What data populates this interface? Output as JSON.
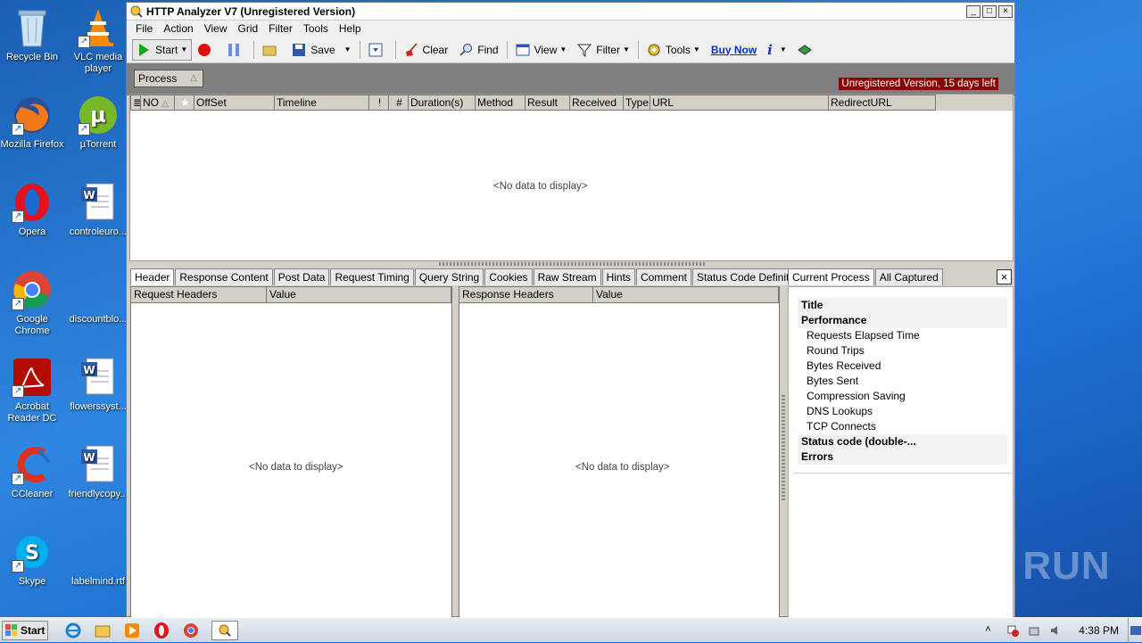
{
  "desktop": {
    "icons": [
      {
        "label": "Recycle Bin"
      },
      {
        "label": "VLC media player"
      },
      {
        "label": "Mozilla Firefox"
      },
      {
        "label": "µTorrent"
      },
      {
        "label": "Opera"
      },
      {
        "label": "controleuro..."
      },
      {
        "label": "Google Chrome"
      },
      {
        "label": "discountblo..."
      },
      {
        "label": "Acrobat Reader DC"
      },
      {
        "label": "flowerssyst..."
      },
      {
        "label": "CCleaner"
      },
      {
        "label": "friendlycopy..."
      },
      {
        "label": "Skype"
      },
      {
        "label": "labelmind.rtf"
      }
    ],
    "watermark": "ANY RUN"
  },
  "window": {
    "title": "HTTP Analyzer V7  (Unregistered Version)",
    "controls": [
      "_",
      "□",
      "×"
    ]
  },
  "menu": [
    "File",
    "Action",
    "View",
    "Grid",
    "Filter",
    "Tools",
    "Help"
  ],
  "toolbar": {
    "start": "Start",
    "save": "Save",
    "clear": "Clear",
    "find": "Find",
    "view": "View",
    "filter": "Filter",
    "tools": "Tools",
    "buy_now": "Buy Now"
  },
  "strip": {
    "process_label": "Process",
    "unregistered_notice": "Unregistered Version, 15 days left"
  },
  "grid": {
    "columns": [
      "",
      "NO",
      "",
      "OffSet",
      "Timeline",
      "!",
      "#",
      "Duration(s)",
      "Method",
      "Result",
      "Received",
      "Type",
      "URL",
      "RedirectURL"
    ],
    "empty_text": "<No data to display>"
  },
  "detail_tabs": [
    "Header",
    "Response Content",
    "Post Data",
    "Request Timing",
    "Query String",
    "Cookies",
    "Raw Stream",
    "Hints",
    "Comment",
    "Status Code Definition"
  ],
  "request_panel": {
    "col_name": "Request Headers",
    "col_value": "Value",
    "empty_text": "<No data to display>"
  },
  "response_panel": {
    "col_name": "Response Headers",
    "col_value": "Value",
    "empty_text": "<No data to display>"
  },
  "right_tabs": [
    "Current Process",
    "All Captured"
  ],
  "right_tree": [
    {
      "label": "Title",
      "kind": "bold"
    },
    {
      "label": "Performance",
      "kind": "bold"
    },
    {
      "label": "Requests Elapsed Time",
      "kind": "sub"
    },
    {
      "label": "Round Trips",
      "kind": "sub"
    },
    {
      "label": "Bytes Received",
      "kind": "sub"
    },
    {
      "label": "Bytes Sent",
      "kind": "sub"
    },
    {
      "label": "Compression Saving",
      "kind": "sub"
    },
    {
      "label": "DNS Lookups",
      "kind": "sub"
    },
    {
      "label": "TCP Connects",
      "kind": "sub"
    },
    {
      "label": "Status code (double-...",
      "kind": "bold"
    },
    {
      "label": "Errors",
      "kind": "bold"
    }
  ],
  "taskbar": {
    "start": "Start",
    "clock": "4:38 PM"
  }
}
